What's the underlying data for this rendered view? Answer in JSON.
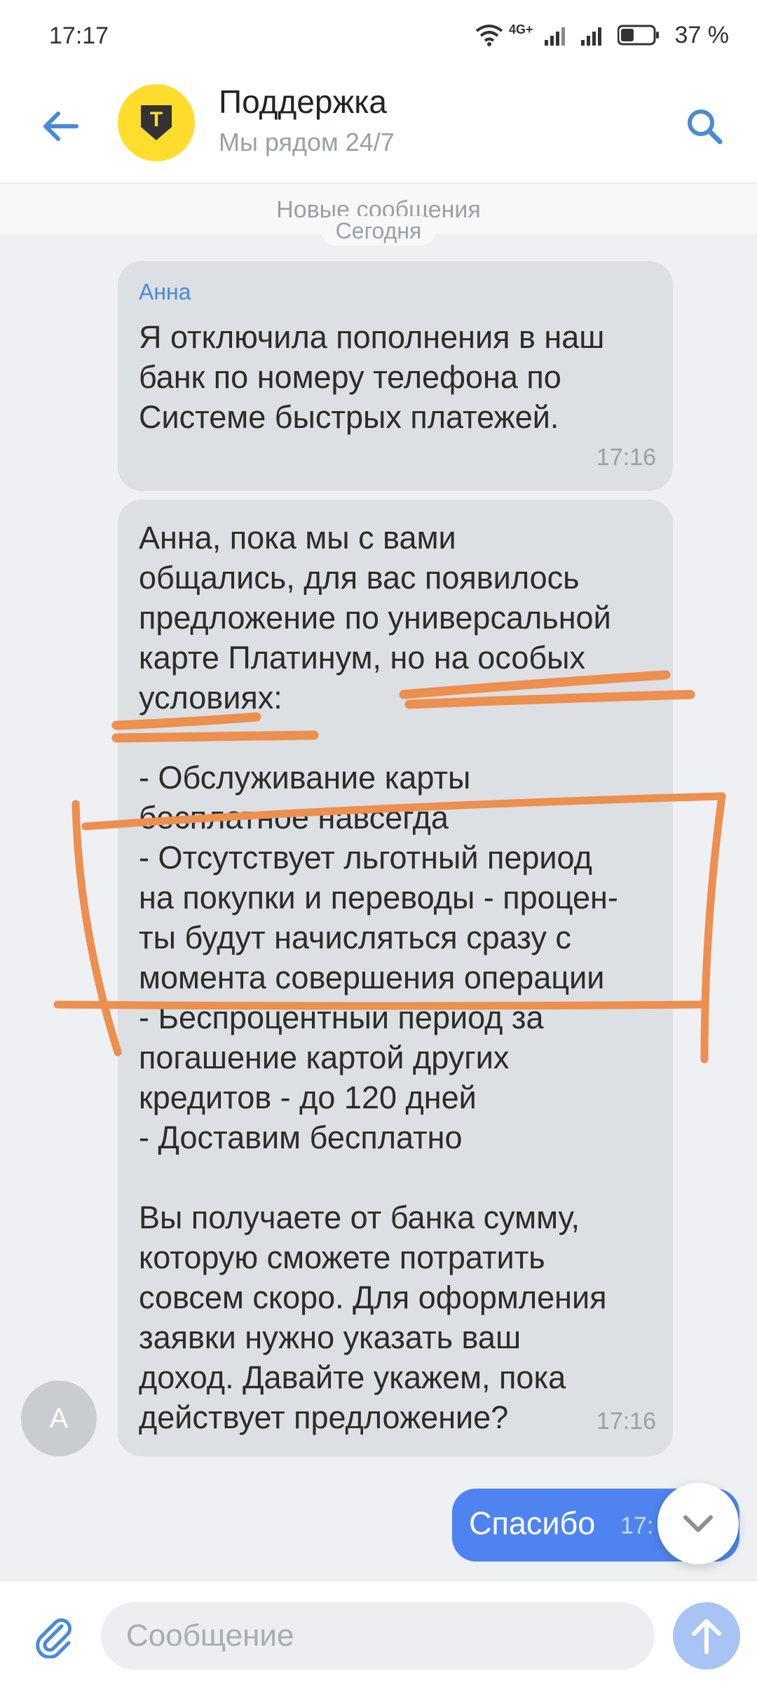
{
  "status_bar": {
    "time": "17:17",
    "network_label": "4G+",
    "battery": "37 %"
  },
  "header": {
    "title": "Поддержка",
    "subtitle": "Мы рядом 24/7",
    "logo_letter": "Т",
    "colors": {
      "logo_bg": "#ffdd2d",
      "accent": "#4a8ad6"
    }
  },
  "chat": {
    "new_messages_label": "Новые сообщения",
    "date_label": "Сегодня",
    "messages": [
      {
        "sender": "Анна",
        "text": "Я отключила пополнения в наш\nбанк по номеру телефона по\nСистеме быстрых платежей.",
        "time": "17:16",
        "direction": "incoming"
      },
      {
        "sender": "",
        "text": "Анна, пока мы с вами\nобщались, для вас появилось\nпредложение по универсальной\nкарте Платинум, но на особых\nусловиях:\n\n- Обслуживание карты\nбесплатное навсегда\n- Отсутствует льготный период\nна покупки и переводы - процен-\nты будут начисляться сразу с\nмомента совершения операции\n- Беспроцентный период за\nпогашение картой других\nкредитов - до 120 дней\n- Доставим бесплатно\n\nВы получаете от банка сумму,\nкоторую сможете потратить\nсовсем скоро. Для оформления\nзаявки нужно указать ваш\nдоход. Давайте укажем, пока\nдействует предложение?",
        "time": "17:16",
        "direction": "incoming"
      },
      {
        "text": "Спасибо",
        "time": "17:",
        "direction": "outgoing"
      }
    ],
    "agent_avatar_letter": "А",
    "annotation_color": "#ec8f4f"
  },
  "input": {
    "placeholder": "Сообщение"
  }
}
